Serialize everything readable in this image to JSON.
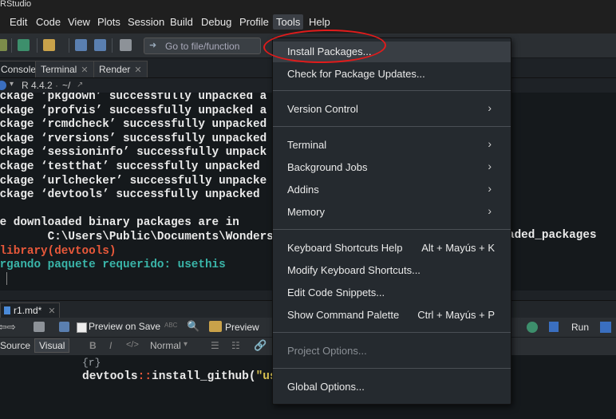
{
  "window": {
    "title": "RStudio"
  },
  "menubar": [
    "Edit",
    "Code",
    "View",
    "Plots",
    "Session",
    "Build",
    "Debug",
    "Profile",
    "Tools",
    "Help"
  ],
  "toolbar": {
    "goto_placeholder": "Go to file/function"
  },
  "console_tabs": [
    "Console",
    "Terminal",
    "Render"
  ],
  "console_info": {
    "r_version": "R 4.4.2",
    "path": "~/"
  },
  "console_lines": [
    {
      "text": "ackage ‘pkgdown’ successfully unpacked a",
      "color": "#eaeaea"
    },
    {
      "text": "ackage ‘profvis’ successfully unpacked a",
      "color": "#eaeaea"
    },
    {
      "text": "ackage ‘rcmdcheck’ successfully unpacked",
      "color": "#eaeaea"
    },
    {
      "text": "ackage ‘rversions’ successfully unpacked",
      "color": "#eaeaea"
    },
    {
      "text": "ackage ‘sessioninfo’ successfully unpack",
      "color": "#eaeaea"
    },
    {
      "text": "ackage ‘testthat’ successfully unpacked",
      "color": "#eaeaea"
    },
    {
      "text": "ackage ‘urlchecker’ successfully unpacke",
      "color": "#eaeaea"
    },
    {
      "text": "ackage ‘devtools’ successfully unpacked",
      "color": "#eaeaea"
    },
    {
      "text": "",
      "color": "#eaeaea"
    },
    {
      "text": "he downloaded binary packages are in",
      "color": "#eaeaea"
    },
    {
      "text": "        C:\\Users\\Public\\Documents\\Wonders",
      "color": "#eaeaea"
    },
    {
      "text": " library(devtools)",
      "color": "#e8583a"
    },
    {
      "text": "argando paquete requerido: usethis",
      "color": "#3ab5a9"
    }
  ],
  "console_overflow": "aded_packages",
  "editor": {
    "tab": "r1.md*",
    "preview_on_save": "Preview on Save",
    "preview": "Preview",
    "run": "Run",
    "mode_source": "Source",
    "mode_visual": "Visual",
    "style_normal": "Normal",
    "code_chunk_header": "{r}",
    "code_line_ns": "devtools",
    "code_line_op": "::",
    "code_line_fn": "install_github(",
    "code_line_str": "\"us"
  },
  "tools_menu": {
    "items": [
      {
        "label": "Install Packages...",
        "shortcut": "",
        "submenu": false,
        "disabled": false
      },
      {
        "label": "Check for Package Updates...",
        "shortcut": "",
        "submenu": false,
        "disabled": false
      },
      {
        "label": "Version Control",
        "shortcut": "",
        "submenu": true,
        "disabled": false
      },
      {
        "label": "Terminal",
        "shortcut": "",
        "submenu": true,
        "disabled": false
      },
      {
        "label": "Background Jobs",
        "shortcut": "",
        "submenu": true,
        "disabled": false
      },
      {
        "label": "Addins",
        "shortcut": "",
        "submenu": true,
        "disabled": false
      },
      {
        "label": "Memory",
        "shortcut": "",
        "submenu": true,
        "disabled": false
      },
      {
        "label": "Keyboard Shortcuts Help",
        "shortcut": "Alt + Mayús + K",
        "submenu": false,
        "disabled": false
      },
      {
        "label": "Modify Keyboard Shortcuts...",
        "shortcut": "",
        "submenu": false,
        "disabled": false
      },
      {
        "label": "Edit Code Snippets...",
        "shortcut": "",
        "submenu": false,
        "disabled": false
      },
      {
        "label": "Show Command Palette",
        "shortcut": "Ctrl + Mayús + P",
        "submenu": false,
        "disabled": false
      },
      {
        "label": "Project Options...",
        "shortcut": "",
        "submenu": false,
        "disabled": true
      },
      {
        "label": "Global Options...",
        "shortcut": "",
        "submenu": false,
        "disabled": false
      }
    ]
  },
  "annotation_color": "#e11b1b"
}
